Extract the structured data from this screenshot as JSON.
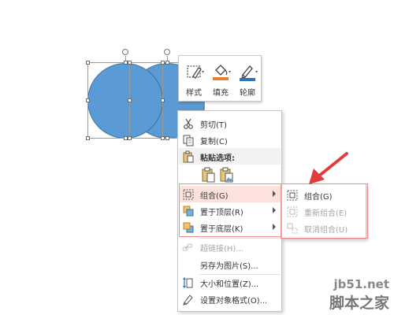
{
  "mini_toolbar": {
    "style": {
      "label": "样式",
      "icon": "shape-style-icon"
    },
    "fill": {
      "label": "填充",
      "icon": "paint-bucket-icon",
      "color": "#ed7d31"
    },
    "outline": {
      "label": "轮廓",
      "icon": "pen-outline-icon",
      "color": "#2e75b6"
    }
  },
  "context_menu": {
    "items": [
      {
        "label": "剪切(T)",
        "icon": "scissors-icon"
      },
      {
        "label": "复制(C)",
        "icon": "copy-icon"
      },
      {
        "label": "粘贴选项:",
        "icon": "paste-icon"
      },
      {
        "label": "组合(G)",
        "icon": "group-icon"
      },
      {
        "label": "置于顶层(R)",
        "icon": "bring-to-front-icon"
      },
      {
        "label": "置于底层(K)",
        "icon": "send-to-back-icon"
      },
      {
        "label": "超链接(H)...",
        "icon": "hyperlink-icon"
      },
      {
        "label": "另存为图片(S)...",
        "icon": ""
      },
      {
        "label": "大小和位置(Z)...",
        "icon": "size-position-icon"
      },
      {
        "label": "设置对象格式(O)...",
        "icon": "format-object-icon"
      }
    ]
  },
  "submenu": {
    "items": [
      {
        "label": "组合(G)",
        "icon": "group-icon"
      },
      {
        "label": "重新组合(E)",
        "icon": "regroup-icon"
      },
      {
        "label": "取消组合(U)",
        "icon": "ungroup-icon"
      }
    ]
  },
  "watermark": {
    "site": "jb51.net",
    "brand": "脚本之家"
  },
  "colors": {
    "shape_fill": "#5b9bd5",
    "highlight": "#fde1dd",
    "annotation": "#e03c3c"
  }
}
